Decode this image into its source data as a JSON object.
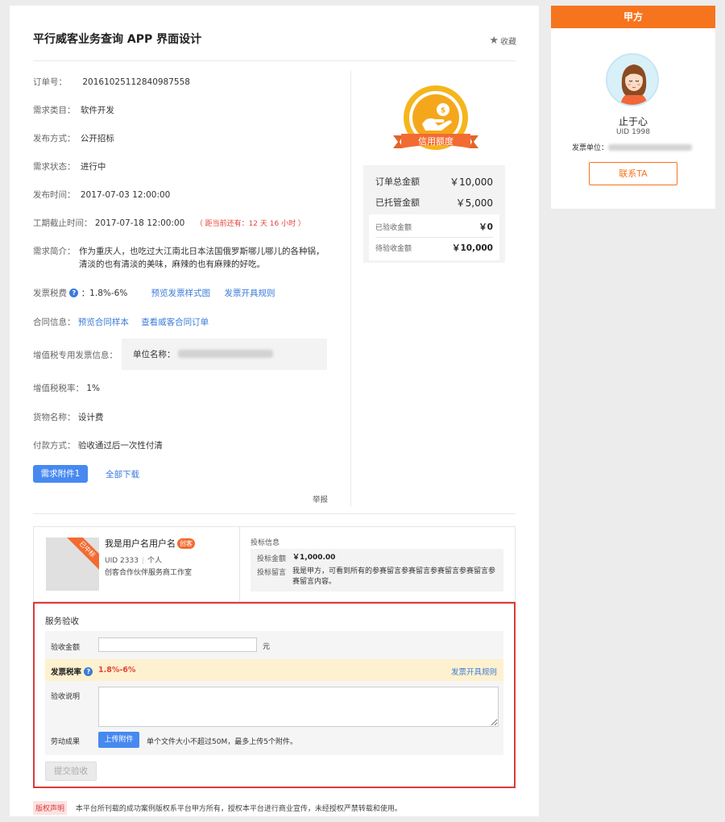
{
  "header": {
    "title": "平行威客业务查询 APP 界面设计",
    "favorite_label": "收藏"
  },
  "details": {
    "order_no": {
      "label": "订单号：",
      "value": "20161025112840987558"
    },
    "category": {
      "label": "需求类目：",
      "value": "软件开发"
    },
    "publish_mode": {
      "label": "发布方式：",
      "value": "公开招标"
    },
    "status": {
      "label": "需求状态：",
      "value": "进行中"
    },
    "publish_time": {
      "label": "发布时间：",
      "value": "2017-07-03 12:00:00"
    },
    "deadline": {
      "label": "工期截止时间：",
      "value": "2017-07-18 12:00:00",
      "remaining": "（ 距当前还有：12 天 16 小时 ）"
    },
    "summary": {
      "label": "需求简介：",
      "value": "作为重庆人，也吃过大江南北日本法国俄罗斯哪儿哪儿的各种锅，清淡的也有清淡的美味，麻辣的也有麻辣的好吃。"
    },
    "invoice_tax": {
      "label": "发票税费",
      "help_icon": "?",
      "value": "：1.8%-6%",
      "link1": "预览发票样式图",
      "link2": "发票开具规则"
    },
    "contract": {
      "label": "合同信息：",
      "link1": "预览合同样本",
      "link2": "查看威客合同订单"
    },
    "vat_invoice": {
      "label": "增值税专用发票信息：",
      "unit_label": "单位名称："
    },
    "vat_rate": {
      "label": "增值税税率：",
      "value": "1%"
    },
    "goods": {
      "label": "货物名称：",
      "value": "设计费"
    },
    "payment": {
      "label": "付款方式：",
      "value": "验收通过后一次性付清"
    },
    "attachment_button": "需求附件1",
    "download_all": "全部下载",
    "report": "举报"
  },
  "credit": {
    "badge_label": "信用额度",
    "total": {
      "label": "订单总金额",
      "value": "￥10,000"
    },
    "escrow": {
      "label": "已托管金额",
      "value": "￥5,000"
    },
    "accepted": {
      "label": "已验收金额",
      "value": "￥0"
    },
    "pending": {
      "label": "待验收金额",
      "value": "￥10,000"
    }
  },
  "bidder": {
    "ribbon": "已中标",
    "name": "我是用户名用户名",
    "tag": "创客",
    "uid": "UID 2333",
    "type": "个人",
    "studio": "创客合作伙伴服务商工作室",
    "info_title": "投标信息",
    "amount_label": "投标金额",
    "amount_value": "￥1,000.00",
    "message_label": "投标留言",
    "message_value": "我是甲方，可看到所有的参赛留言参赛留言参赛留言参赛留言参赛留言内容。"
  },
  "service": {
    "title": "服务验收",
    "amount_label": "验收金额",
    "amount_value": "",
    "unit": "元",
    "tax_label": "发票税率",
    "tax_help_icon": "?",
    "tax_value": "1.8%-6%",
    "tax_link": "发票开具规则",
    "note_label": "验收说明",
    "note_value": "",
    "result_label": "劳动成果",
    "upload_button": "上传附件",
    "upload_hint": "单个文件大小不超过50M，最多上传5个附件。",
    "submit_button": "提交验收"
  },
  "copyright": {
    "tag": "版权声明",
    "text": "本平台所刊载的成功案例版权系平台甲方所有，授权本平台进行商业宣传，未经授权严禁转载和使用。"
  },
  "sidebar": {
    "header": "甲方",
    "name": "止于心",
    "uid": "UID 1998",
    "invoice_unit_label": "发票单位：",
    "contact_button": "联系TA"
  },
  "colors": {
    "accent_orange": "#f7741e",
    "link_blue": "#3a7ad9",
    "button_blue": "#4789f0",
    "highlight_red": "#d93a3a"
  }
}
